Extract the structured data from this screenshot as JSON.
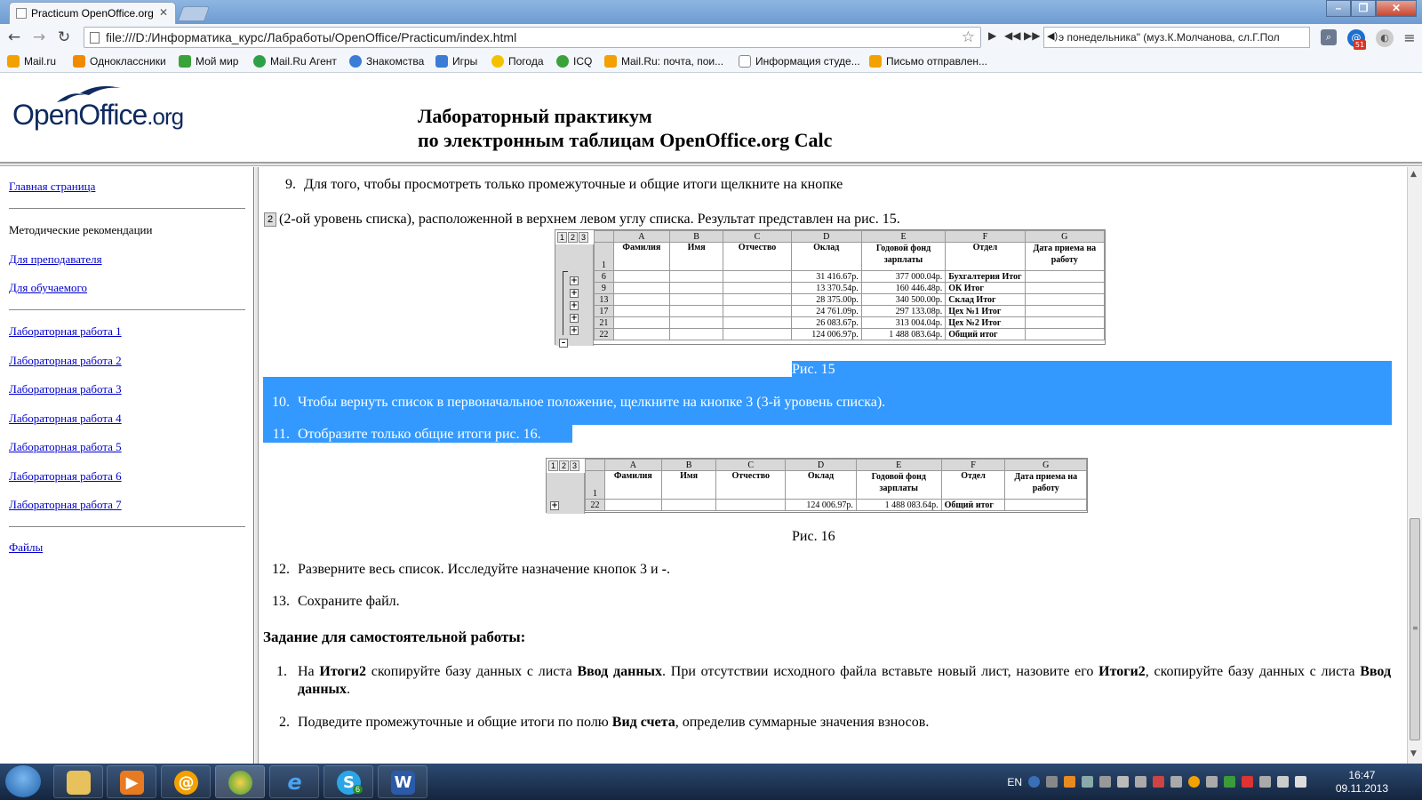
{
  "browser": {
    "tab_title": "Practicum OpenOffice.org",
    "tab_close": "✕",
    "url": "file:///D:/Информатика_курс/Лабработы/OpenOffice/Practicum/index.html",
    "player_song": "э понедельника\" (муз.К.Молчанова, сл.Г.Пол",
    "ext_badge": "51",
    "window_controls": {
      "minimize": "–",
      "maximize": "❐",
      "close": "✕"
    },
    "bookmarks": [
      {
        "label": "Mail.ru",
        "color": "#f2a100"
      },
      {
        "label": "Одноклассники",
        "color": "#f28a00"
      },
      {
        "label": "Мой мир",
        "color": "#3aa23a"
      },
      {
        "label": "Mail.Ru Агент",
        "color": "#2fa04a"
      },
      {
        "label": "Знакомства",
        "color": "#3a7cd6"
      },
      {
        "label": "Игры",
        "color": "#3a7cd6"
      },
      {
        "label": "Погода",
        "color": "#f2c200"
      },
      {
        "label": "ICQ",
        "color": "#3aa23a"
      },
      {
        "label": "Mail.Ru: почта, пои...",
        "color": "#f2a100"
      },
      {
        "label": "Информация студе...",
        "color": "#ffffff"
      },
      {
        "label": "Письмо отправлен...",
        "color": "#f2a100"
      }
    ]
  },
  "header": {
    "logo_main": "OpenOffice",
    "logo_org": ".org",
    "title_line1": "Лабораторный практикум",
    "title_line2": "по электронным таблицам OpenOffice.org Calc"
  },
  "sidebar": {
    "home": "Главная страница",
    "method_title": "Методические рекомендации",
    "for_teacher": "Для преподавателя",
    "for_student": "Для обучаемого",
    "labs": [
      "Лабораторная работа 1",
      "Лабораторная работа 2",
      "Лабораторная работа 3",
      "Лабораторная работа 4",
      "Лабораторная работа 5",
      "Лабораторная работа 6",
      "Лабораторная работа 7"
    ],
    "files": "Файлы"
  },
  "content": {
    "item9_num": "9.",
    "item9_text": "Для того, чтобы просмотреть только промежуточные и общие итоги щелкните на кнопке",
    "item9_kbd": "2",
    "item9_cont": "(2-ой уровень списка), расположенной в верхнем левом углу списка. Результат представлен на рис. 15.",
    "fig15_caption": "Рис. 15",
    "item10_num": "10.",
    "item10_text": "Чтобы вернуть список в первоначальное положение, щелкните на кнопке 3 (3-й уровень списка).",
    "item11_num": "11.",
    "item11_text": "Отобразите только общие итоги рис. 16.",
    "fig16_caption": "Рис. 16",
    "item12_num": "12.",
    "item12_text_a": "Разверните весь список. Исследуйте назначение кнопок 3 и ",
    "item12_text_b": "-",
    "item12_text_c": ".",
    "item13_num": "13.",
    "item13_text": "Сохраните файл.",
    "task_heading": "Задание для самостоятельной работы:",
    "task1_num": "1.",
    "task1_parts": [
      "На ",
      "Итоги2",
      " скопируйте базу данных с листа ",
      "Ввод данных",
      ". При отсутствии исходного файла вставьте новый лист, назовите его ",
      "Итоги2",
      ", скопируйте базу данных с листа ",
      "Ввод данных",
      "."
    ],
    "task2_num": "2.",
    "task2_parts": [
      "Подведите промежуточные и общие итоги по полю ",
      "Вид счета",
      ", определив суммарные значения взносов."
    ]
  },
  "sheet15": {
    "level_buttons": [
      "1",
      "2",
      "3"
    ],
    "columns": [
      "A",
      "B",
      "C",
      "D",
      "E",
      "F",
      "G"
    ],
    "headers": [
      "Фамилия",
      "Имя",
      "Отчество",
      "Оклад",
      "Годовой фонд зарплаты",
      "Отдел",
      "Дата приема на работу"
    ],
    "header_row": "1",
    "rows": [
      {
        "rn": "6",
        "btn": "+",
        "d": "31 416.67р.",
        "e": "377 000.04р.",
        "f": "Бухгалтерия Итог"
      },
      {
        "rn": "9",
        "btn": "+",
        "d": "13 370.54р.",
        "e": "160 446.48р.",
        "f": "ОК Итог"
      },
      {
        "rn": "13",
        "btn": "+",
        "d": "28 375.00р.",
        "e": "340 500.00р.",
        "f": "Склад Итог"
      },
      {
        "rn": "17",
        "btn": "+",
        "d": "24 761.09р.",
        "e": "297 133.08р.",
        "f": "Цех №1 Итог"
      },
      {
        "rn": "21",
        "btn": "+",
        "d": "26 083.67р.",
        "e": "313 004.04р.",
        "f": "Цех №2 Итог"
      },
      {
        "rn": "22",
        "btn": "–",
        "d": "124 006.97р.",
        "e": "1 488 083.64р.",
        "f": "Общий итог"
      }
    ]
  },
  "sheet16": {
    "level_buttons": [
      "1",
      "2",
      "3"
    ],
    "columns": [
      "A",
      "B",
      "C",
      "D",
      "E",
      "F",
      "G"
    ],
    "headers": [
      "Фамилия",
      "Имя",
      "Отчество",
      "Оклад",
      "Годовой фонд зарплаты",
      "Отдел",
      "Дата приема на работу"
    ],
    "header_row": "1",
    "row": {
      "rn": "22",
      "btn": "+",
      "d": "124 006.97р.",
      "e": "1 488 083.64р.",
      "f": "Общий итог"
    }
  },
  "taskbar": {
    "lang": "EN",
    "time": "16:47",
    "date": "09.11.2013",
    "skype_badge": "6"
  }
}
